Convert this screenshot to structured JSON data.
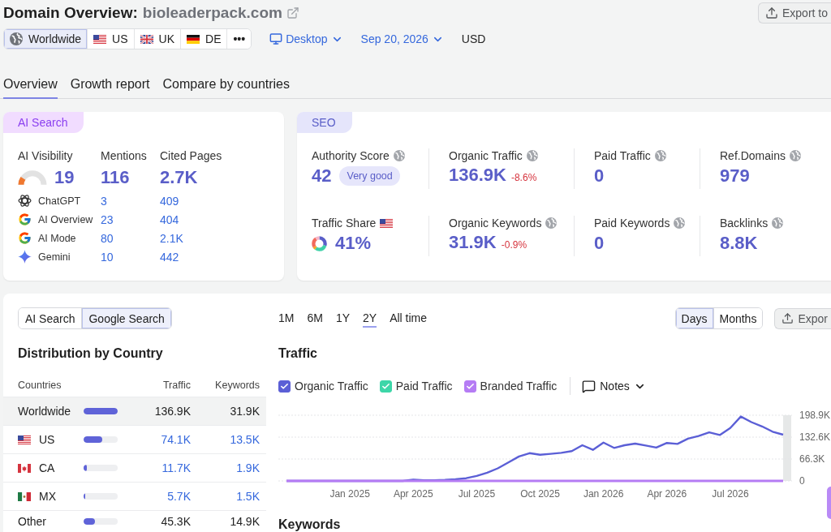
{
  "header": {
    "title": "Domain Overview:",
    "domain": "bioleaderpack.com",
    "export_button": "Export to"
  },
  "filters": {
    "regions": [
      {
        "kind": "globe",
        "label": "Worldwide",
        "selected": true
      },
      {
        "kind": "us",
        "label": "US",
        "selected": false
      },
      {
        "kind": "uk",
        "label": "UK",
        "selected": false
      },
      {
        "kind": "de",
        "label": "DE",
        "selected": false
      },
      {
        "kind": "more",
        "label": "•••",
        "selected": false
      }
    ],
    "device": "Desktop",
    "date": "Sep 20, 2026",
    "currency": "USD"
  },
  "tabs": [
    {
      "label": "Overview",
      "selected": true
    },
    {
      "label": "Growth report",
      "selected": false
    },
    {
      "label": "Compare by countries",
      "selected": false
    }
  ],
  "ai_search": {
    "tag": "AI Search",
    "columns": [
      "AI Visibility",
      "Mentions",
      "Cited Pages"
    ],
    "visibility": {
      "value": "19",
      "level": 0.19
    },
    "mentions": "116",
    "cited_pages": "2.7K",
    "platforms": [
      {
        "kind": "chatgpt",
        "name": "ChatGPT",
        "mentions": "3",
        "cited_pages": "409"
      },
      {
        "kind": "google",
        "name": "AI Overview",
        "mentions": "23",
        "cited_pages": "404"
      },
      {
        "kind": "google",
        "name": "AI Mode",
        "mentions": "80",
        "cited_pages": "2.1K"
      },
      {
        "kind": "gemini",
        "name": "Gemini",
        "mentions": "10",
        "cited_pages": "442"
      }
    ]
  },
  "seo": {
    "tag": "SEO",
    "metrics": [
      {
        "kind": "score",
        "label": "Authority Score",
        "value": "42",
        "badge": "Very good"
      },
      {
        "kind": "trend",
        "label": "Organic Traffic",
        "value": "136.9K",
        "change": "-8.6%"
      },
      {
        "kind": "plain",
        "label": "Paid Traffic",
        "value": "0"
      },
      {
        "kind": "plain",
        "label": "Ref.Domains",
        "value": "979"
      },
      {
        "kind": "share",
        "label": "Traffic Share",
        "value": "41%"
      },
      {
        "kind": "trend",
        "label": "Organic Keywords",
        "value": "31.9K",
        "change": "-0.9%"
      },
      {
        "kind": "plain",
        "label": "Paid Keywords",
        "value": "0"
      },
      {
        "kind": "plain",
        "label": "Backlinks",
        "value": "8.8K"
      }
    ]
  },
  "distribution": {
    "sources": [
      {
        "label": "AI Search",
        "selected": false
      },
      {
        "label": "Google Search",
        "selected": true
      }
    ],
    "title": "Distribution by Country",
    "columns": [
      "Countries",
      "Traffic",
      "Keywords"
    ],
    "rows": [
      {
        "kind": "total",
        "country": "Worldwide",
        "level": 1,
        "traffic": "136.9K",
        "keywords": "31.9K",
        "selected": true
      },
      {
        "kind": "us",
        "country": "US",
        "level": 0.54,
        "traffic": "74.1K",
        "keywords": "13.5K",
        "selected": false
      },
      {
        "kind": "ca",
        "country": "CA",
        "level": 0.09,
        "traffic": "11.7K",
        "keywords": "1.9K",
        "selected": false
      },
      {
        "kind": "mx",
        "country": "MX",
        "level": 0.04,
        "traffic": "5.7K",
        "keywords": "1.5K",
        "selected": false
      },
      {
        "kind": "total",
        "country": "Other",
        "level": 0.33,
        "traffic": "45.3K",
        "keywords": "14.9K",
        "selected": false
      }
    ]
  },
  "traffic": {
    "ranges": [
      {
        "label": "1M",
        "selected": false
      },
      {
        "label": "6M",
        "selected": false
      },
      {
        "label": "1Y",
        "selected": false
      },
      {
        "label": "2Y",
        "selected": true
      },
      {
        "label": "All time",
        "selected": false
      }
    ],
    "intervals": [
      {
        "label": "Days",
        "selected": true
      },
      {
        "label": "Months",
        "selected": false
      }
    ],
    "export_button": "Expor",
    "title": "Traffic",
    "legend": [
      {
        "checked": true
      },
      {
        "checked": true
      },
      {
        "checked": true
      }
    ],
    "notes": "Notes",
    "chart_data": {
      "type": "line",
      "categories": [
        null,
        null,
        null,
        null,
        null,
        null,
        "Jan 2025",
        null,
        null,
        null,
        null,
        null,
        "Apr 2025",
        null,
        null,
        null,
        null,
        null,
        "Jul 2025",
        null,
        null,
        null,
        null,
        null,
        "Oct 2025",
        null,
        null,
        null,
        null,
        null,
        "Jan 2026",
        null,
        null,
        null,
        null,
        null,
        "Apr 2026",
        null,
        null,
        null,
        null,
        null,
        "Jul 2026",
        null,
        null,
        null,
        null,
        null
      ],
      "ylim": [
        0,
        198.9
      ],
      "yticks": [
        {
          "value": 0,
          "label": "0"
        },
        {
          "value": 66.3,
          "label": "66.3K"
        },
        {
          "value": 132.6,
          "label": "132.6K"
        },
        {
          "value": 198.9,
          "label": "198.9K"
        }
      ],
      "series": [
        {
          "name": "Organic Traffic",
          "color": "#5b5fd6",
          "values": [
            0,
            0,
            0,
            0,
            0,
            0,
            0,
            0,
            0,
            0,
            0,
            0,
            4,
            2,
            2,
            3,
            5,
            8,
            15,
            25,
            38,
            56,
            74,
            84,
            79,
            82,
            85,
            90,
            108,
            94,
            116,
            100,
            108,
            113,
            107,
            101,
            115,
            112,
            128,
            136,
            147,
            139,
            160,
            195,
            178,
            165,
            149,
            140
          ]
        },
        {
          "name": "Paid Traffic",
          "color": "#3dd6a8",
          "values": [
            null,
            null,
            null,
            null,
            null,
            null,
            null,
            null,
            null,
            null,
            null,
            null,
            null,
            null,
            null,
            null,
            null,
            null,
            null,
            null,
            null,
            null,
            null,
            null,
            null,
            null,
            null,
            null,
            null,
            null,
            null,
            null,
            null,
            null,
            null,
            null,
            null,
            null,
            null,
            null,
            null,
            null,
            null,
            null,
            null,
            null,
            null,
            null
          ]
        },
        {
          "name": "Branded Traffic",
          "color": "#b57cf4",
          "values": [
            0,
            0,
            0,
            0,
            0,
            0,
            0,
            0,
            0,
            0,
            0,
            0,
            0,
            0,
            0,
            0,
            0,
            0,
            0,
            0,
            0,
            0,
            0,
            0,
            0,
            0,
            0,
            0,
            0,
            0,
            0,
            0,
            0,
            0,
            0,
            0,
            0,
            0,
            0,
            0,
            0,
            0,
            0,
            0,
            0,
            0,
            0,
            0
          ]
        }
      ]
    }
  },
  "keywords": {
    "title": "Keywords"
  }
}
